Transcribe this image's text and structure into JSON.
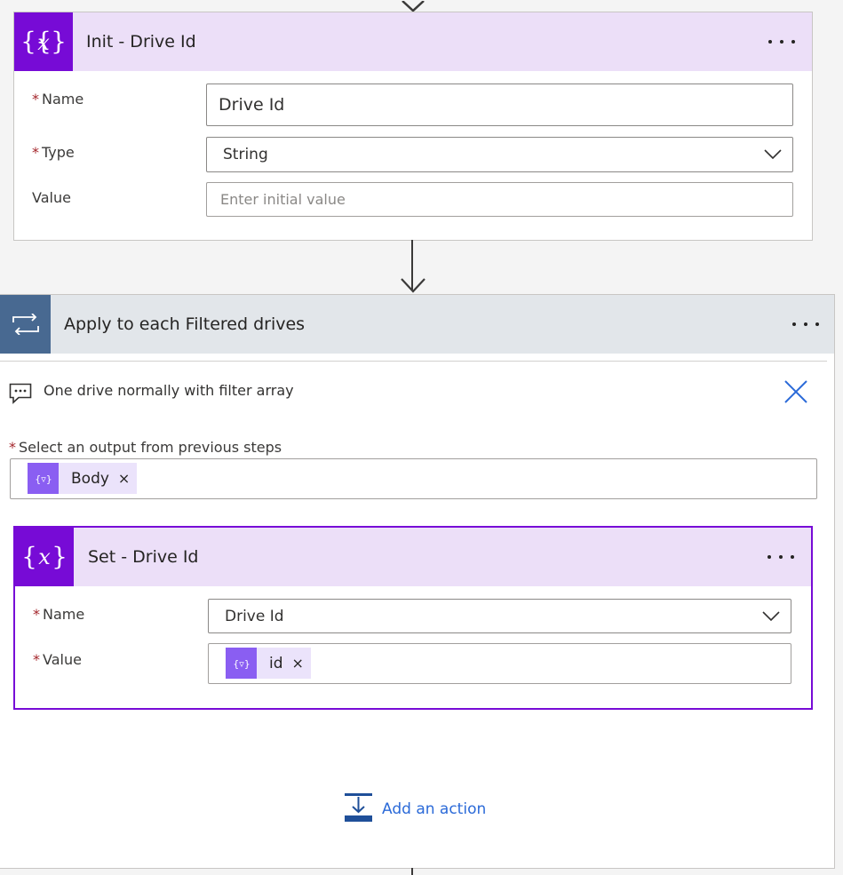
{
  "init_card": {
    "title": "Init - Drive Id",
    "name_label": "Name",
    "name_value": "Drive Id",
    "type_label": "Type",
    "type_value": "String",
    "value_label": "Value",
    "value_placeholder": "Enter initial value",
    "required_mark": "*",
    "more_icon": "more-dots-icon"
  },
  "loop_card": {
    "title": "Apply to each Filtered drives",
    "comment": "One drive normally with filter array",
    "select_label": "Select an output from previous steps",
    "required_mark": "*",
    "token_label": "Body",
    "token_remove": "×"
  },
  "set_card": {
    "title": "Set - Drive Id",
    "name_label": "Name",
    "name_value": "Drive Id",
    "value_label": "Value",
    "token_label": "id",
    "token_remove": "×",
    "required_mark": "*"
  },
  "add_action": {
    "label": "Add an action"
  },
  "colors": {
    "variable_accent": "#770bd6",
    "variable_header": "#ecdff8",
    "loop_accent": "#486991",
    "loop_header": "#e2e6ea",
    "link": "#2b6ad8",
    "required": "#a4262c"
  }
}
